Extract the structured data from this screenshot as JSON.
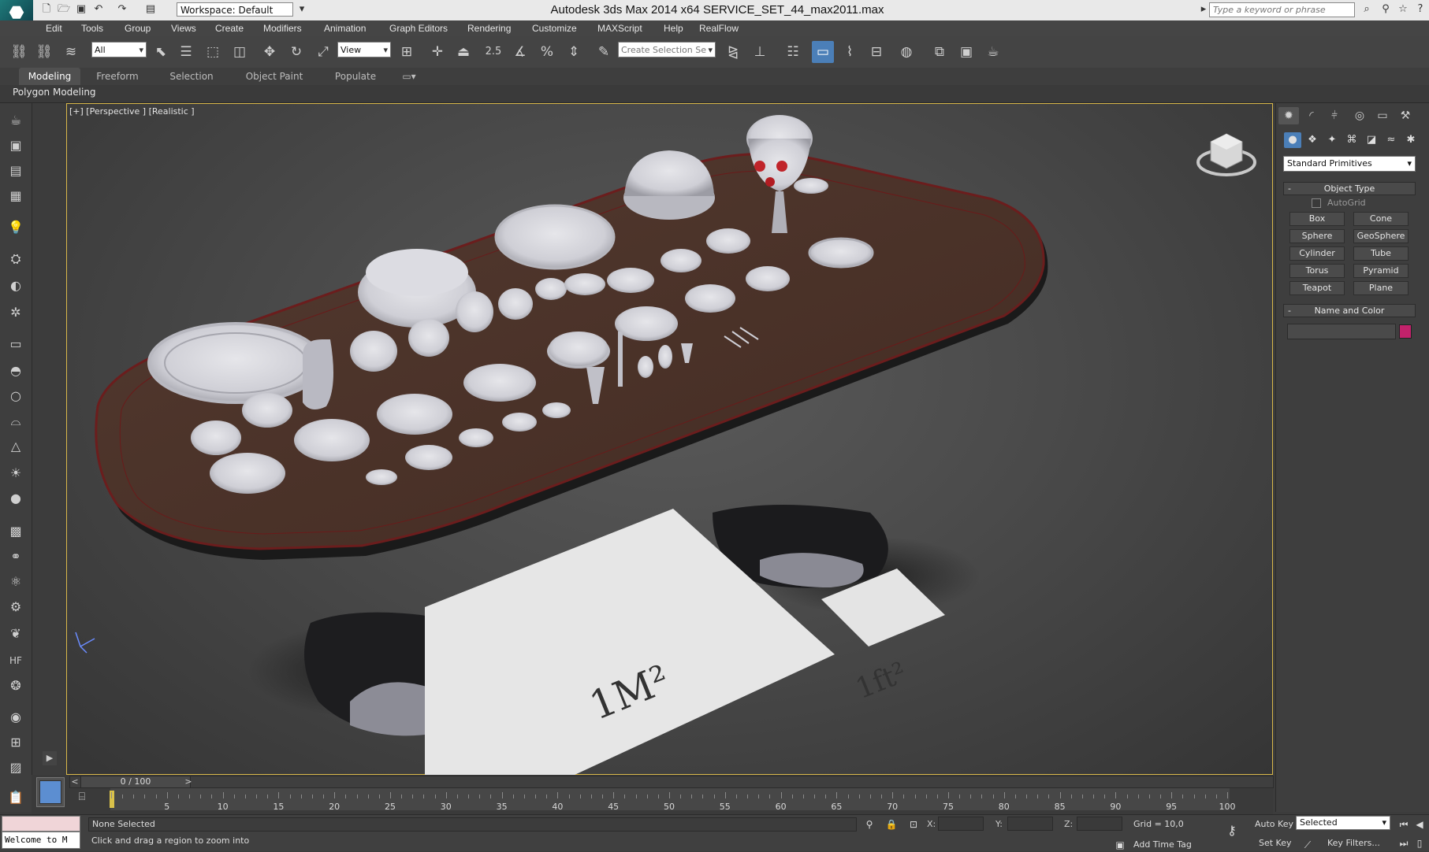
{
  "titlebar": {
    "workspace": "Workspace: Default",
    "title": "Autodesk 3ds Max  2014 x64     SERVICE_SET_44_max2011.max",
    "search_placeholder": "Type a keyword or phrase"
  },
  "menu": [
    "Edit",
    "Tools",
    "Group",
    "Views",
    "Create",
    "Modifiers",
    "Animation",
    "Graph Editors",
    "Rendering",
    "Customize",
    "MAXScript",
    "Help",
    "RealFlow"
  ],
  "toolbar": {
    "filter": "All",
    "ref_coord": "View",
    "snap_angle": "2.5",
    "selection_set_placeholder": "Create Selection Se"
  },
  "ribbon": {
    "tabs": [
      "Modeling",
      "Freeform",
      "Selection",
      "Object Paint",
      "Populate"
    ],
    "active_tab": "Modeling",
    "panel_label": "Polygon Modeling"
  },
  "viewport": {
    "label": "[+] [Perspective ] [Realistic ]",
    "ground_tile_1": "1M²",
    "ground_tile_2": "1ft²"
  },
  "command_panel": {
    "category": "Standard Primitives",
    "object_type_title": "Object Type",
    "autogrid": "AutoGrid",
    "buttons": [
      "Box",
      "Cone",
      "Sphere",
      "GeoSphere",
      "Cylinder",
      "Tube",
      "Torus",
      "Pyramid",
      "Teapot",
      "Plane"
    ],
    "name_color_title": "Name and Color",
    "object_color": "#c2226b"
  },
  "timeline": {
    "slider": "0 / 100",
    "ticks": [
      "5",
      "10",
      "15",
      "20",
      "25",
      "30",
      "35",
      "40",
      "45",
      "50",
      "55",
      "60",
      "65",
      "70",
      "75",
      "80",
      "85",
      "90",
      "95",
      "100"
    ]
  },
  "status": {
    "listener": "Welcome to M",
    "selection": "None Selected",
    "prompt": "Click and drag a region to zoom into",
    "x_label": "X:",
    "y_label": "Y:",
    "z_label": "Z:",
    "grid": "Grid = 10,0",
    "add_time_tag": "Add Time Tag",
    "auto_key": "Auto Key",
    "set_key": "Set Key",
    "key_mode": "Selected",
    "key_filters": "Key Filters..."
  },
  "colors": {
    "accent": "#4b7fb8",
    "viewport_border": "#d9b84a",
    "table_top": "#4a3128",
    "time_marker": "#d9c14a"
  }
}
